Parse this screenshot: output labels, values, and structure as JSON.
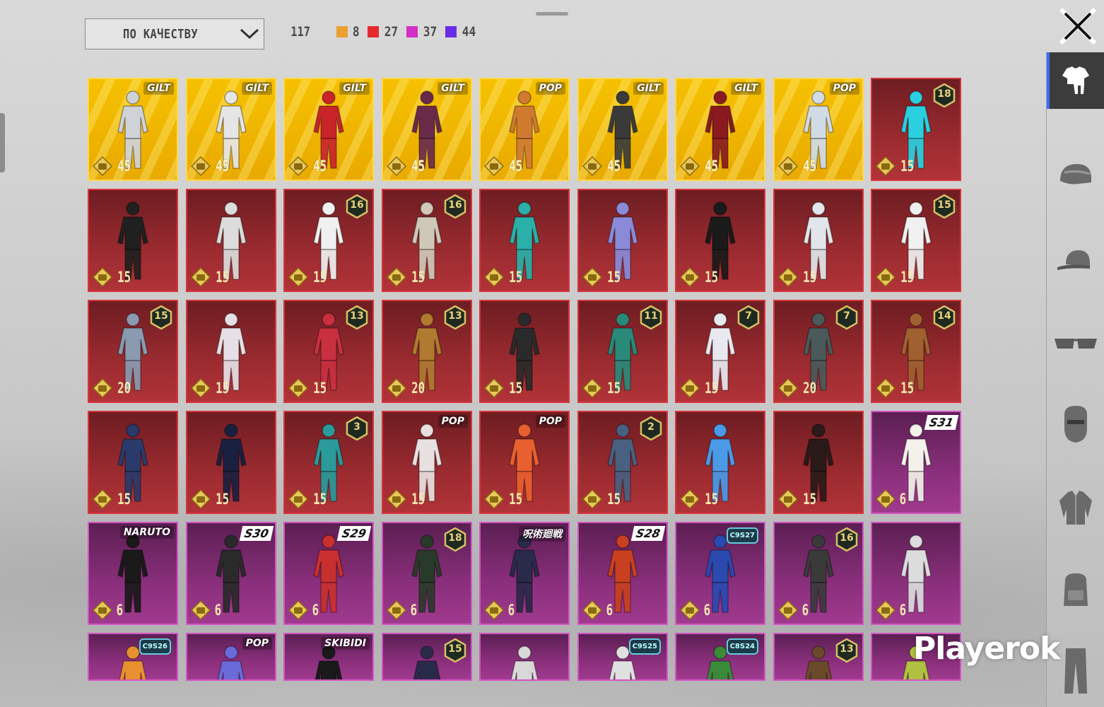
{
  "sort": {
    "label": "ПО КАЧЕСТВУ"
  },
  "counts": {
    "total": "117",
    "items": [
      {
        "color": "#e8a030",
        "value": "8"
      },
      {
        "color": "#e8282f",
        "value": "27"
      },
      {
        "color": "#d42fc6",
        "value": "37"
      },
      {
        "color": "#6a2ce6",
        "value": "44"
      }
    ]
  },
  "watermark": "Playerok",
  "sidebar": [
    "outfit-icon",
    "helmet-icon",
    "cap-icon",
    "glasses-icon",
    "mask-icon",
    "jacket-icon",
    "backpack-icon",
    "pants-icon"
  ],
  "colors": {
    "gold": "#f6c100",
    "red": "#9b2b30",
    "purple": "#8a2f7c",
    "accent": "#3b6cff"
  },
  "items": [
    {
      "r": "gold",
      "p": "45",
      "b": "GILT",
      "bt": "brand",
      "c": "#cfd2d6"
    },
    {
      "r": "gold",
      "p": "45",
      "b": "GILT",
      "bt": "brand",
      "c": "#e5e5e5"
    },
    {
      "r": "gold",
      "p": "45",
      "b": "GILT",
      "bt": "brand",
      "c": "#c8242a"
    },
    {
      "r": "gold",
      "p": "45",
      "b": "GILT",
      "bt": "brand",
      "c": "#6a2a4a"
    },
    {
      "r": "gold",
      "p": "45",
      "b": "POP",
      "bt": "brand",
      "c": "#d07a30"
    },
    {
      "r": "gold",
      "p": "45",
      "b": "GILT",
      "bt": "brand",
      "c": "#3a3a3a"
    },
    {
      "r": "gold",
      "p": "45",
      "b": "GILT",
      "bt": "brand",
      "c": "#8a1a20"
    },
    {
      "r": "gold",
      "p": "45",
      "b": "POP",
      "bt": "brand",
      "c": "#d0dbe6"
    },
    {
      "r": "red",
      "p": "15",
      "b": "18",
      "bt": "level",
      "c": "#2ad0e0"
    },
    {
      "r": "red",
      "p": "15",
      "b": "",
      "bt": "",
      "c": "#202020"
    },
    {
      "r": "red",
      "p": "15",
      "b": "",
      "bt": "",
      "c": "#dcdcdc"
    },
    {
      "r": "red",
      "p": "15",
      "b": "16",
      "bt": "level",
      "c": "#f0f0f0"
    },
    {
      "r": "red",
      "p": "15",
      "b": "16",
      "bt": "level",
      "c": "#cfc8b8"
    },
    {
      "r": "red",
      "p": "15",
      "b": "",
      "bt": "",
      "c": "#2ab0a8"
    },
    {
      "r": "red",
      "p": "15",
      "b": "",
      "bt": "",
      "c": "#8a8ad8"
    },
    {
      "r": "red",
      "p": "15",
      "b": "",
      "bt": "",
      "c": "#1a1a1a"
    },
    {
      "r": "red",
      "p": "15",
      "b": "",
      "bt": "",
      "c": "#e0e6ea"
    },
    {
      "r": "red",
      "p": "15",
      "b": "15",
      "bt": "level",
      "c": "#f0f0f0"
    },
    {
      "r": "red",
      "p": "20",
      "b": "15",
      "bt": "level",
      "c": "#8a9ab0"
    },
    {
      "r": "red",
      "p": "15",
      "b": "",
      "bt": "",
      "c": "#e6e0e6"
    },
    {
      "r": "red",
      "p": "15",
      "b": "13",
      "bt": "level",
      "c": "#c83040"
    },
    {
      "r": "red",
      "p": "20",
      "b": "13",
      "bt": "level",
      "c": "#b07a30"
    },
    {
      "r": "red",
      "p": "15",
      "b": "",
      "bt": "",
      "c": "#2a2a2a"
    },
    {
      "r": "red",
      "p": "15",
      "b": "11",
      "bt": "level",
      "c": "#2a8a7a"
    },
    {
      "r": "red",
      "p": "15",
      "b": "7",
      "bt": "level",
      "c": "#e8e8f0"
    },
    {
      "r": "red",
      "p": "20",
      "b": "7",
      "bt": "level",
      "c": "#4a5a5a"
    },
    {
      "r": "red",
      "p": "15",
      "b": "14",
      "bt": "level",
      "c": "#a06030"
    },
    {
      "r": "red",
      "p": "15",
      "b": "",
      "bt": "",
      "c": "#2a3a6a"
    },
    {
      "r": "red",
      "p": "15",
      "b": "",
      "bt": "",
      "c": "#1a2040"
    },
    {
      "r": "red",
      "p": "15",
      "b": "3",
      "bt": "level",
      "c": "#2a9a9a"
    },
    {
      "r": "red",
      "p": "15",
      "b": "POP",
      "bt": "brand",
      "c": "#e8e0e0"
    },
    {
      "r": "red",
      "p": "15",
      "b": "POP",
      "bt": "brand",
      "c": "#e86030"
    },
    {
      "r": "red",
      "p": "15",
      "b": "2",
      "bt": "level",
      "c": "#4a6080"
    },
    {
      "r": "red",
      "p": "15",
      "b": "",
      "bt": "",
      "c": "#4a9ae8"
    },
    {
      "r": "red",
      "p": "15",
      "b": "",
      "bt": "",
      "c": "#2a1a1a"
    },
    {
      "r": "purple",
      "p": "6",
      "b": "S31",
      "bt": "season",
      "c": "#f4f0ea"
    },
    {
      "r": "purple",
      "p": "6",
      "b": "NARUTO",
      "bt": "brand",
      "c": "#1a1a1a"
    },
    {
      "r": "purple",
      "p": "6",
      "b": "S30",
      "bt": "season",
      "c": "#2a2a2a"
    },
    {
      "r": "purple",
      "p": "6",
      "b": "S29",
      "bt": "season",
      "c": "#c83030"
    },
    {
      "r": "purple",
      "p": "6",
      "b": "18",
      "bt": "level",
      "c": "#2a3a2a"
    },
    {
      "r": "purple",
      "p": "6",
      "b": "呪術廻戦",
      "bt": "brand",
      "c": "#2a2a4a"
    },
    {
      "r": "purple",
      "p": "6",
      "b": "S28",
      "bt": "season",
      "c": "#c84020"
    },
    {
      "r": "purple",
      "p": "6",
      "b": "C9S27",
      "bt": "cs",
      "c": "#2a4ab0"
    },
    {
      "r": "purple",
      "p": "6",
      "b": "16",
      "bt": "level",
      "c": "#3a3a3a"
    },
    {
      "r": "purple",
      "p": "6",
      "b": "",
      "bt": "",
      "c": "#dcdcdc"
    },
    {
      "r": "purple",
      "p": "",
      "b": "C9S26",
      "bt": "cs",
      "c": "#e89030"
    },
    {
      "r": "purple",
      "p": "",
      "b": "POP",
      "bt": "brand",
      "c": "#6a6ad8"
    },
    {
      "r": "purple",
      "p": "",
      "b": "SKIBIDI",
      "bt": "brand",
      "c": "#1a1a1a"
    },
    {
      "r": "purple",
      "p": "",
      "b": "15",
      "bt": "level",
      "c": "#2a2a4a"
    },
    {
      "r": "purple",
      "p": "",
      "b": "",
      "bt": "",
      "c": "#d8d8d8"
    },
    {
      "r": "purple",
      "p": "",
      "b": "C9S25",
      "bt": "cs",
      "c": "#e0e0e0"
    },
    {
      "r": "purple",
      "p": "",
      "b": "C8S24",
      "bt": "cs",
      "c": "#3a8a3a"
    },
    {
      "r": "purple",
      "p": "",
      "b": "13",
      "bt": "level",
      "c": "#6a4a2a"
    },
    {
      "r": "purple",
      "p": "",
      "b": "",
      "bt": "",
      "c": "#b0c040"
    }
  ]
}
